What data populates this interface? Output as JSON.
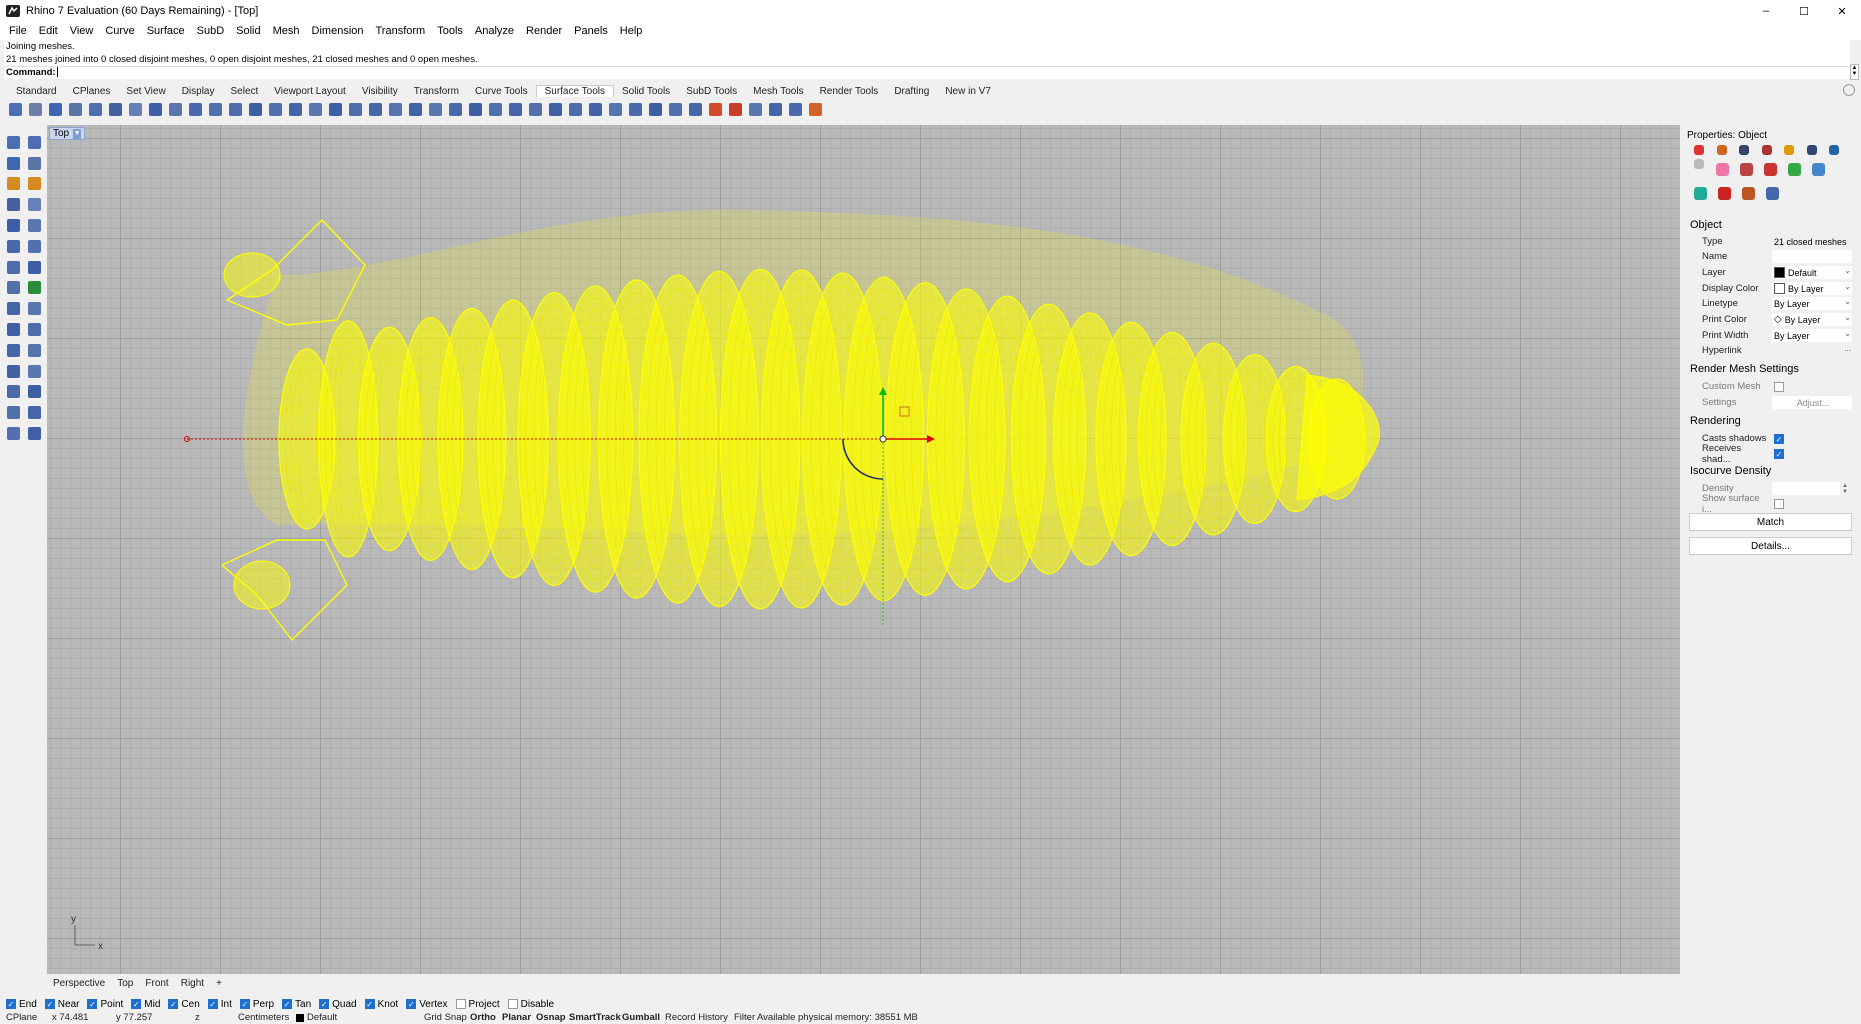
{
  "window": {
    "title": "Rhino 7 Evaluation (60 Days Remaining) - [Top]",
    "minimize": "–",
    "maximize": "☐",
    "close": "✕"
  },
  "menu": [
    "File",
    "Edit",
    "View",
    "Curve",
    "Surface",
    "SubD",
    "Solid",
    "Mesh",
    "Dimension",
    "Transform",
    "Tools",
    "Analyze",
    "Render",
    "Panels",
    "Help"
  ],
  "command": {
    "history_line1": "Joining meshes.",
    "history_line2": "21 meshes joined into 0 closed disjoint meshes, 0 open disjoint meshes, 21 closed meshes and 0 open meshes.",
    "prompt": "Command:"
  },
  "toolbar_tabs": [
    "Standard",
    "CPlanes",
    "Set View",
    "Display",
    "Select",
    "Viewport Layout",
    "Visibility",
    "Transform",
    "Curve Tools",
    "Surface Tools",
    "Solid Tools",
    "SubD Tools",
    "Mesh Tools",
    "Render Tools",
    "Drafting",
    "New in V7"
  ],
  "toolbar_icons": [
    {
      "name": "new-icon",
      "color": "#4a6fb5"
    },
    {
      "name": "open-icon",
      "color": "#6b7fa8"
    },
    {
      "name": "save-icon",
      "color": "#3f66b0"
    },
    {
      "name": "print-icon",
      "color": "#5a74a6"
    },
    {
      "name": "import-icon",
      "color": "#4f6db0"
    },
    {
      "name": "undo-icon",
      "color": "#4460a0"
    },
    {
      "name": "pan-icon",
      "color": "#6780b8"
    },
    {
      "name": "rotate-view-icon",
      "color": "#3d5fa8"
    },
    {
      "name": "zoom-icon",
      "color": "#5c75ac"
    },
    {
      "name": "zoom-window-icon",
      "color": "#4868ad"
    },
    {
      "name": "zoom-extents-icon",
      "color": "#5070b0"
    },
    {
      "name": "set-view-icon",
      "color": "#4d6ca9"
    },
    {
      "name": "viewport-icon",
      "color": "#3e5ea4"
    },
    {
      "name": "select-icon",
      "color": "#5271aa"
    },
    {
      "name": "move-icon",
      "color": "#4565a8"
    },
    {
      "name": "copy-icon",
      "color": "#5a76ae"
    },
    {
      "name": "rotate-icon",
      "color": "#3f5fa6"
    },
    {
      "name": "scale-icon",
      "color": "#4e6cab"
    },
    {
      "name": "mirror-icon",
      "color": "#4766a9"
    },
    {
      "name": "array-icon",
      "color": "#5573ad"
    },
    {
      "name": "join-icon",
      "color": "#4262a7"
    },
    {
      "name": "explode-icon",
      "color": "#5b77af"
    },
    {
      "name": "trim-icon",
      "color": "#4a69aa"
    },
    {
      "name": "split-icon",
      "color": "#3d5da5"
    },
    {
      "name": "group-icon",
      "color": "#5070ac"
    },
    {
      "name": "ungroup-icon",
      "color": "#4565a8"
    },
    {
      "name": "layer-icon",
      "color": "#536fae"
    },
    {
      "name": "properties-icon",
      "color": "#3f5fa6"
    },
    {
      "name": "osnap-icon",
      "color": "#4e6cab"
    },
    {
      "name": "grid-icon",
      "color": "#4363a8"
    },
    {
      "name": "cplane-icon",
      "color": "#5674ad"
    },
    {
      "name": "hide-icon",
      "color": "#4a69aa"
    },
    {
      "name": "show-icon",
      "color": "#3e5ea4"
    },
    {
      "name": "lock-icon",
      "color": "#5271aa"
    },
    {
      "name": "shade-icon",
      "color": "#4766a9"
    },
    {
      "name": "render-icon",
      "color": "#d14a2a"
    },
    {
      "name": "materials-icon",
      "color": "#c63d2b"
    },
    {
      "name": "curve-tool-icon",
      "color": "#5b77af"
    },
    {
      "name": "dimension-icon",
      "color": "#4565a8"
    },
    {
      "name": "measure-icon",
      "color": "#4a69aa"
    },
    {
      "name": "analyze-icon",
      "color": "#d0622a"
    }
  ],
  "left_icons": [
    {
      "name": "select-arrow-icon",
      "color": "#4a6fb5"
    },
    {
      "name": "point-icon",
      "color": "#4f6db0"
    },
    {
      "name": "line-icon",
      "color": "#3f66b0"
    },
    {
      "name": "polyline-icon",
      "color": "#5a74a6"
    },
    {
      "name": "curve-icon",
      "color": "#d48a1f"
    },
    {
      "name": "freeform-icon",
      "color": "#d48a1f"
    },
    {
      "name": "circle-icon",
      "color": "#4460a0"
    },
    {
      "name": "arc-icon",
      "color": "#6780b8"
    },
    {
      "name": "ellipse-icon",
      "color": "#3d5fa8"
    },
    {
      "name": "polygon-icon",
      "color": "#5c75ac"
    },
    {
      "name": "rectangle-icon",
      "color": "#4868ad"
    },
    {
      "name": "surface-icon",
      "color": "#5070b0"
    },
    {
      "name": "extrude-icon",
      "color": "#4d6ca9"
    },
    {
      "name": "loft-icon",
      "color": "#3e5ea4"
    },
    {
      "name": "revolve-icon",
      "color": "#5271aa"
    },
    {
      "name": "sweep-icon",
      "color": "#2b8c3a"
    },
    {
      "name": "box-icon",
      "color": "#4565a8"
    },
    {
      "name": "sphere-icon",
      "color": "#5a76ae"
    },
    {
      "name": "cylinder-icon",
      "color": "#3f5fa6"
    },
    {
      "name": "cone-icon",
      "color": "#4e6cab"
    },
    {
      "name": "boolean-icon",
      "color": "#4766a9"
    },
    {
      "name": "fillet-icon",
      "color": "#5573ad"
    },
    {
      "name": "mesh-icon",
      "color": "#4262a7"
    },
    {
      "name": "subd-icon",
      "color": "#5b77af"
    },
    {
      "name": "transform-icon",
      "color": "#4a69aa"
    },
    {
      "name": "array-left-icon",
      "color": "#3d5da5"
    },
    {
      "name": "dimension-left-icon",
      "color": "#5070ac"
    },
    {
      "name": "text-icon",
      "color": "#4565a8"
    },
    {
      "name": "block-icon",
      "color": "#536fae"
    },
    {
      "name": "grid-left-icon",
      "color": "#3f5fa6"
    }
  ],
  "viewport": {
    "label": "Top",
    "axis_x": "x",
    "axis_y": "y",
    "tabs": [
      "Perspective",
      "Top",
      "Front",
      "Right"
    ],
    "add_tab": "+",
    "geometry_color": "#ffff00"
  },
  "properties": {
    "title": "Properties: Object",
    "icons_row1": [
      {
        "name": "object-icon",
        "color": "#d33"
      },
      {
        "name": "material-icon",
        "color": "#c62"
      },
      {
        "name": "texture-icon",
        "color": "#346"
      },
      {
        "name": "decal-icon",
        "color": "#a33"
      },
      {
        "name": "folder-icon",
        "color": "#d90"
      },
      {
        "name": "camera-icon",
        "color": "#347"
      },
      {
        "name": "bell-icon",
        "color": "#26a"
      },
      {
        "name": "more-icon",
        "color": "#bbb"
      }
    ],
    "icons_row2": [
      {
        "name": "color-wheel-icon",
        "color": "#e7a"
      },
      {
        "name": "brush-icon",
        "color": "#b44"
      },
      {
        "name": "shape-icon",
        "color": "#c33"
      },
      {
        "name": "green-square-icon",
        "color": "#3a4"
      },
      {
        "name": "sphere-prop-icon",
        "color": "#48c"
      },
      {
        "name": "cube-icon",
        "color": "#2a9"
      },
      {
        "name": "red-box-icon",
        "color": "#c22"
      },
      {
        "name": "ball-icon",
        "color": "#b52"
      },
      {
        "name": "cylinder-prop-icon",
        "color": "#46a"
      }
    ],
    "section_object": "Object",
    "type_label": "Type",
    "type_value": "21 closed meshes",
    "name_label": "Name",
    "name_value": "",
    "layer_label": "Layer",
    "layer_value": "Default",
    "layer_color": "#000000",
    "display_color_label": "Display Color",
    "display_color_value": "By Layer",
    "linetype_label": "Linetype",
    "linetype_value": "By Layer",
    "print_color_label": "Print Color",
    "print_color_value": "By Layer",
    "print_width_label": "Print Width",
    "print_width_value": "By Layer",
    "hyperlink_label": "Hyperlink",
    "hyperlink_value": "...",
    "section_render_mesh": "Render Mesh Settings",
    "custom_mesh_label": "Custom Mesh",
    "settings_label": "Settings",
    "adjust_label": "Adjust...",
    "section_rendering": "Rendering",
    "casts_shadows_label": "Casts shadows",
    "receives_shadows_label": "Receives shad...",
    "section_isocurve": "Isocurve Density",
    "density_label": "Density",
    "show_surface_label": "Show surface i...",
    "match_button": "Match",
    "details_button": "Details..."
  },
  "osnaps": [
    {
      "label": "End",
      "on": true
    },
    {
      "label": "Near",
      "on": true
    },
    {
      "label": "Point",
      "on": true
    },
    {
      "label": "Mid",
      "on": true
    },
    {
      "label": "Cen",
      "on": true
    },
    {
      "label": "Int",
      "on": true
    },
    {
      "label": "Perp",
      "on": true
    },
    {
      "label": "Tan",
      "on": true
    },
    {
      "label": "Quad",
      "on": true
    },
    {
      "label": "Knot",
      "on": true
    },
    {
      "label": "Vertex",
      "on": true
    },
    {
      "label": "Project",
      "on": false
    },
    {
      "label": "Disable",
      "on": false
    }
  ],
  "status": {
    "cplane": "CPlane",
    "x": "x 74.481",
    "y": "y 77.257",
    "z": "z",
    "units": "Centimeters",
    "layer": "Default",
    "grid_snap": "Grid Snap",
    "ortho": "Ortho",
    "planar": "Planar",
    "osnap": "Osnap",
    "smarttrack": "SmartTrack",
    "gumball": "Gumball",
    "record_history": "Record History",
    "filter": "Filter",
    "memory": "Available physical memory: 38551 MB"
  }
}
